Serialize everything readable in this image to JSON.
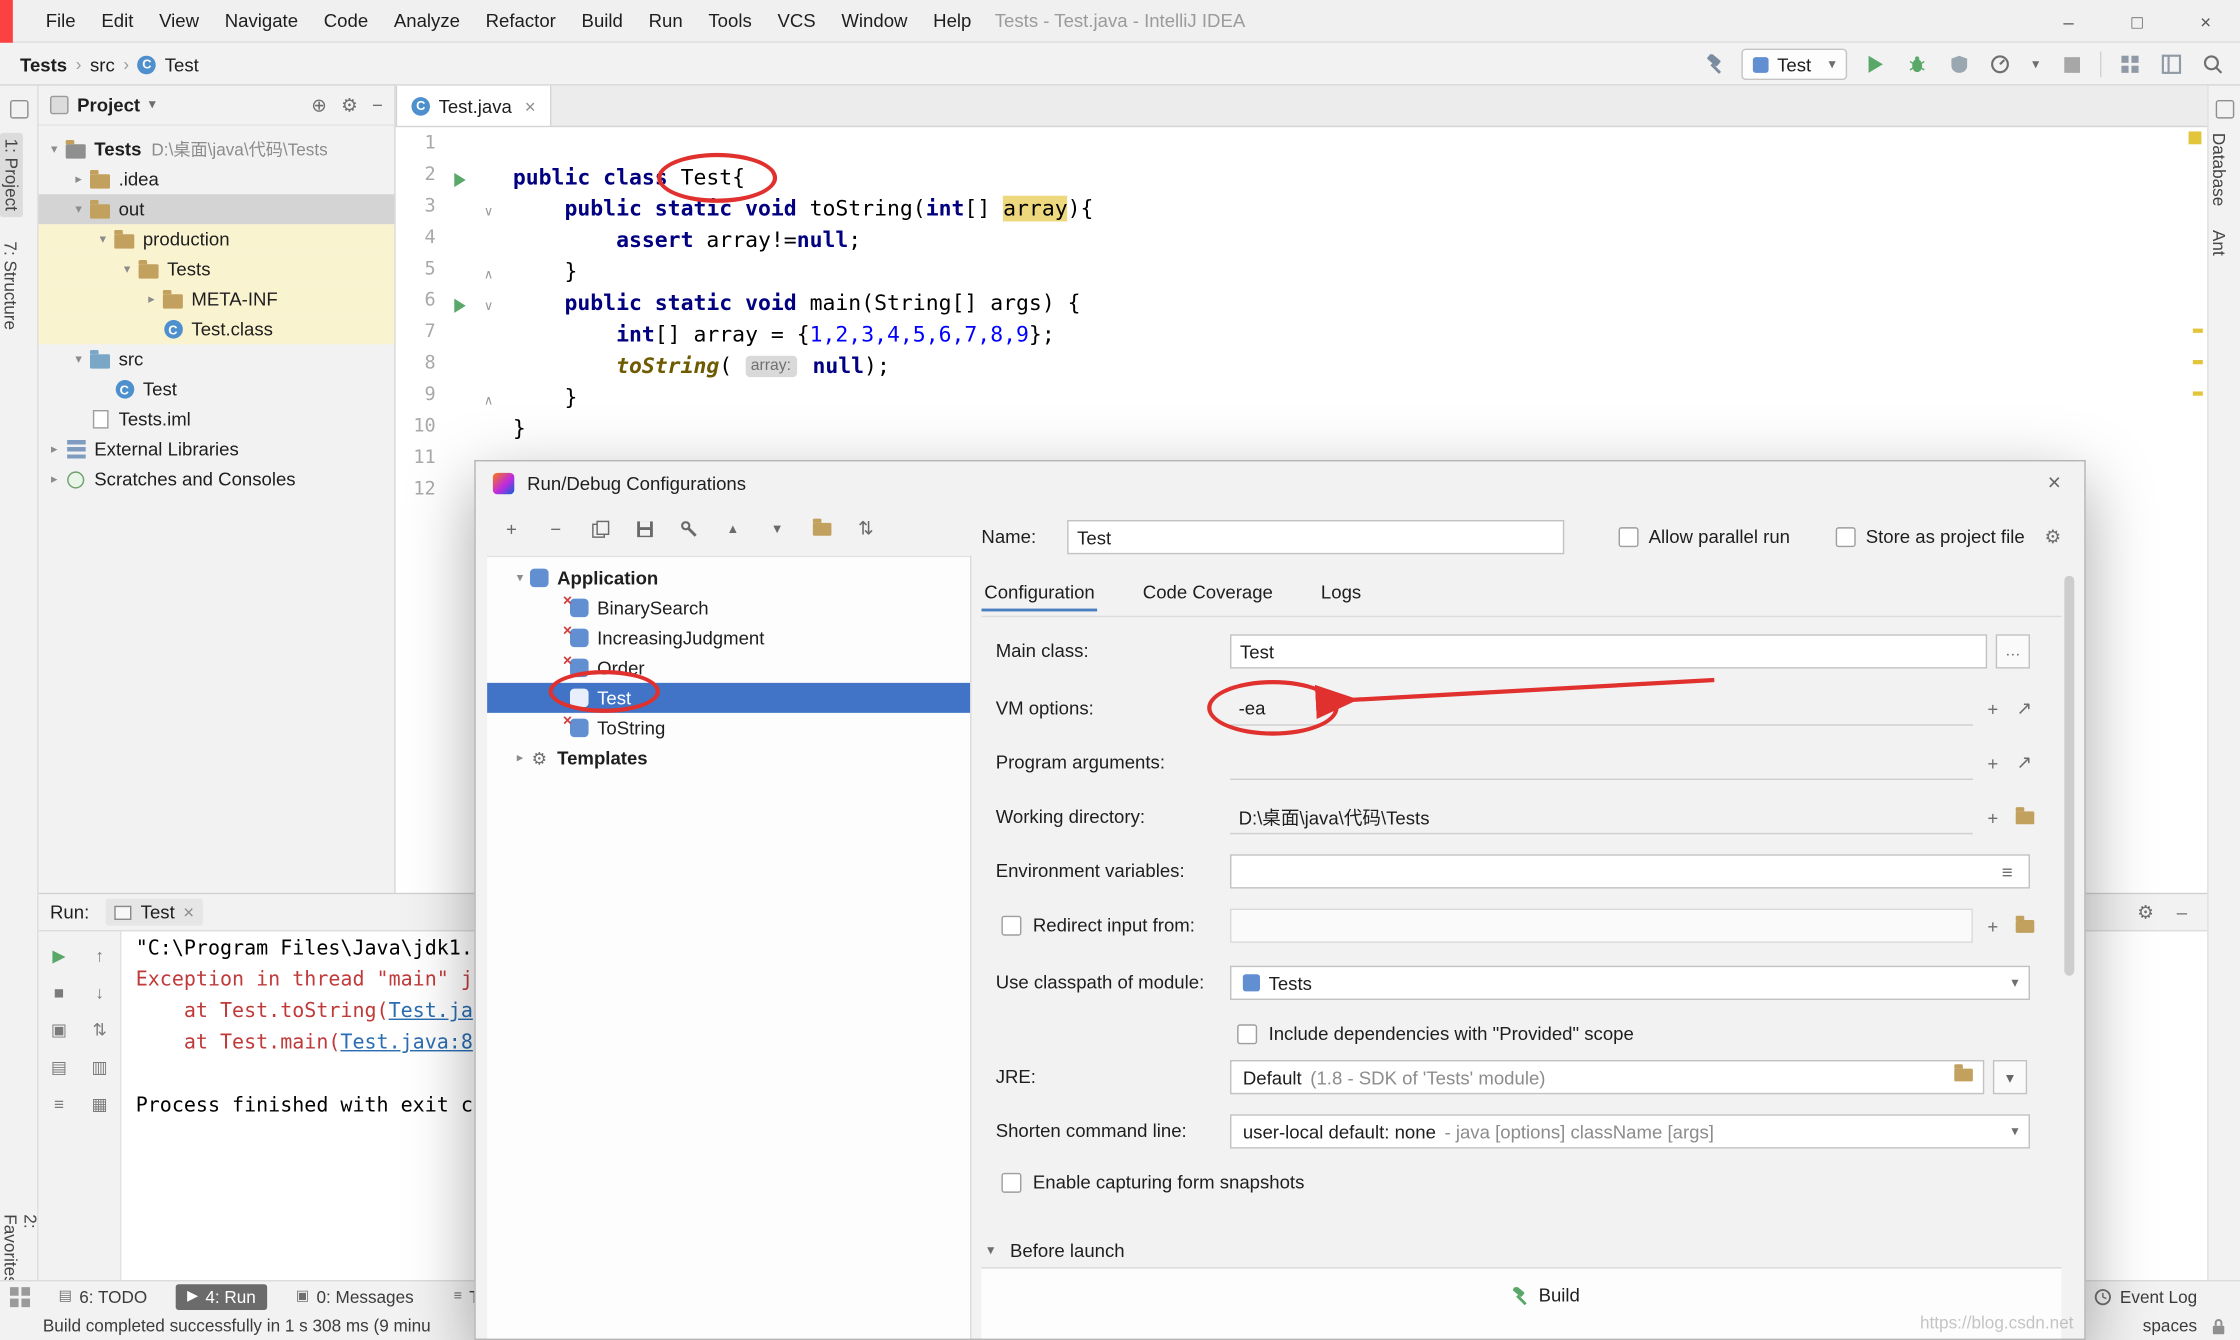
{
  "icons": {
    "crumb": "›",
    "tree_open": "▾",
    "tree_closed": "▸",
    "combo_arrow": "▾",
    "close": "×",
    "minimize": "–",
    "maximize": "□",
    "plus": "+",
    "minus": "−",
    "up": "▲",
    "down": "▼",
    "sort": "⇅",
    "more": "…",
    "gear": "⚙",
    "arrow_up": "↑",
    "arrow_down": "↓",
    "menu": "≡",
    "locate": "⊕",
    "expand": "↗",
    "fold_open": "∨",
    "fold_close": "∧"
  },
  "titlebar": {
    "title": "Tests - Test.java - IntelliJ IDEA",
    "menus": [
      "File",
      "Edit",
      "View",
      "Navigate",
      "Code",
      "Analyze",
      "Refactor",
      "Build",
      "Run",
      "Tools",
      "VCS",
      "Window",
      "Help"
    ]
  },
  "navbar": {
    "breadcrumbs": [
      "Tests",
      "src",
      "Test"
    ],
    "run_config": "Test"
  },
  "stripes": {
    "left_top": [
      "1: Project",
      "7: Structure"
    ],
    "left_bottom": [
      "2: Favorites"
    ],
    "right": [
      "Database",
      "Ant"
    ]
  },
  "project_panel": {
    "title": "Project",
    "tree": [
      {
        "label": "Tests",
        "hint": "D:\\桌面\\java\\代码\\Tests",
        "icon": "project",
        "level": 0,
        "chev": "v",
        "bold": true
      },
      {
        "label": ".idea",
        "icon": "folder",
        "level": 1,
        "chev": ">"
      },
      {
        "label": "out",
        "icon": "folder",
        "level": 1,
        "chev": "v",
        "row": "gray"
      },
      {
        "label": "production",
        "icon": "folder",
        "level": 2,
        "chev": "v",
        "row": "cream"
      },
      {
        "label": "Tests",
        "icon": "folder",
        "level": 3,
        "chev": "v",
        "row": "cream"
      },
      {
        "label": "META-INF",
        "icon": "folder",
        "level": 4,
        "chev": ">",
        "row": "cream"
      },
      {
        "label": "Test.class",
        "icon": "class",
        "level": 4,
        "row": "cream"
      },
      {
        "label": "src",
        "icon": "srcfolder",
        "level": 1,
        "chev": "v"
      },
      {
        "label": "Test",
        "icon": "class",
        "level": 2
      },
      {
        "label": "Tests.iml",
        "icon": "file",
        "level": 1
      },
      {
        "label": "External Libraries",
        "icon": "libs",
        "level": 0,
        "chev": ">"
      },
      {
        "label": "Scratches and Consoles",
        "icon": "scratch",
        "level": 0,
        "chev": ">"
      }
    ]
  },
  "editor": {
    "tab": "Test.java",
    "lines": [
      {
        "n": "1",
        "seg": []
      },
      {
        "n": "2",
        "run": true,
        "seg": [
          {
            "t": "public class ",
            "c": "kw"
          },
          {
            "t": "Test{",
            "c": "p"
          }
        ]
      },
      {
        "n": "3",
        "fold": "v",
        "seg": [
          {
            "t": "    ",
            "c": "p"
          },
          {
            "t": "public static void ",
            "c": "kw"
          },
          {
            "t": "toString(",
            "c": "p"
          },
          {
            "t": "int",
            "c": "kw"
          },
          {
            "t": "[] ",
            "c": "p"
          },
          {
            "t": "array",
            "c": "hl"
          },
          {
            "t": "){",
            "c": "p"
          }
        ]
      },
      {
        "n": "4",
        "seg": [
          {
            "t": "        ",
            "c": "p"
          },
          {
            "t": "assert ",
            "c": "kw"
          },
          {
            "t": "array!=",
            "c": "p"
          },
          {
            "t": "null",
            "c": "kw"
          },
          {
            "t": ";",
            "c": "p"
          }
        ]
      },
      {
        "n": "5",
        "fold": "^",
        "seg": [
          {
            "t": "    }",
            "c": "p"
          }
        ]
      },
      {
        "n": "6",
        "run": true,
        "fold": "v",
        "seg": [
          {
            "t": "    ",
            "c": "p"
          },
          {
            "t": "public static void ",
            "c": "kw"
          },
          {
            "t": "main(String[] args) {",
            "c": "p"
          }
        ]
      },
      {
        "n": "7",
        "seg": [
          {
            "t": "        ",
            "c": "p"
          },
          {
            "t": "int",
            "c": "kw"
          },
          {
            "t": "[] array = {",
            "c": "p"
          },
          {
            "t": "1,2,3,4,5,6,7,8,9",
            "c": "num"
          },
          {
            "t": "};",
            "c": "p"
          }
        ]
      },
      {
        "n": "8",
        "seg": [
          {
            "t": "        ",
            "c": "p"
          },
          {
            "t": "toString",
            "c": "method"
          },
          {
            "t": "( ",
            "c": "p"
          },
          {
            "t": "array:",
            "c": "hint"
          },
          {
            "t": " ",
            "c": "p"
          },
          {
            "t": "null",
            "c": "kw"
          },
          {
            "t": ");",
            "c": "p"
          }
        ]
      },
      {
        "n": "9",
        "fold": "^",
        "seg": [
          {
            "t": "    }",
            "c": "p"
          }
        ]
      },
      {
        "n": "10",
        "seg": [
          {
            "t": "}",
            "c": "p"
          }
        ]
      },
      {
        "n": "11",
        "seg": []
      },
      {
        "n": "12",
        "seg": []
      }
    ]
  },
  "dialog": {
    "title": "Run/Debug Configurations",
    "tree": [
      {
        "label": "Application",
        "icon": "app",
        "level": 0,
        "chev": "v",
        "bold": true
      },
      {
        "label": "BinarySearch",
        "icon": "app-broken",
        "level": 1
      },
      {
        "label": "IncreasingJudgment",
        "icon": "app-broken",
        "level": 1
      },
      {
        "label": "Order",
        "icon": "app-broken",
        "level": 1
      },
      {
        "label": "Test",
        "icon": "app",
        "level": 1,
        "selected": true
      },
      {
        "label": "ToString",
        "icon": "app-broken",
        "level": 1
      },
      {
        "label": "Templates",
        "icon": "wrench",
        "level": 0,
        "chev": ">",
        "bold": true
      }
    ],
    "name_label": "Name:",
    "name_value": "Test",
    "allow_parallel": "Allow parallel run",
    "store_project": "Store as project file",
    "tabs": [
      "Configuration",
      "Code Coverage",
      "Logs"
    ],
    "fields": {
      "main_class": {
        "label": "Main class:",
        "value": "Test"
      },
      "vm_options": {
        "label": "VM options:",
        "value": "-ea"
      },
      "program_args": {
        "label": "Program arguments:",
        "value": ""
      },
      "working_dir": {
        "label": "Working directory:",
        "value": "D:\\桌面\\java\\代码\\Tests"
      },
      "env_vars": {
        "label": "Environment variables:",
        "value": ""
      },
      "redirect": {
        "label": "Redirect input from:",
        "value": ""
      },
      "classpath": {
        "label": "Use classpath of module:",
        "value": "Tests"
      },
      "provided": {
        "label": "Include dependencies with \"Provided\" scope"
      },
      "jre": {
        "label": "JRE:",
        "value": "Default",
        "hint": "(1.8 - SDK of 'Tests' module)"
      },
      "shorten": {
        "label": "Shorten command line:",
        "value": "user-local default: none",
        "hint": "- java [options] className [args]"
      },
      "snapshots": {
        "label": "Enable capturing form snapshots"
      }
    },
    "before_launch": {
      "title": "Before launch",
      "item": "Build"
    }
  },
  "run_panel": {
    "label": "Run:",
    "tab": "Test",
    "toolbar_col1": [
      {
        "name": "rerun-button",
        "glyph": "▶",
        "green": true
      },
      {
        "name": "stop-button",
        "glyph": "■"
      },
      {
        "name": "thread-dump-button",
        "glyph": "▣"
      },
      {
        "name": "restore-layout-button",
        "glyph": "▤"
      },
      {
        "name": "console-settings-button",
        "glyph": "≡"
      }
    ],
    "toolbar_col2": [
      {
        "name": "up-stack-button",
        "glyph": "↑"
      },
      {
        "name": "down-stack-button",
        "glyph": "↓"
      },
      {
        "name": "soft-wrap-button",
        "glyph": "⇅"
      },
      {
        "name": "scroll-end-button",
        "glyph": "▥"
      },
      {
        "name": "print-button",
        "glyph": "▦"
      }
    ],
    "console": [
      [
        {
          "t": "\"C:\\Program Files\\Java\\jdk1.",
          "c": "black"
        }
      ],
      [
        {
          "t": "Exception in thread \"main\" j",
          "c": "red"
        }
      ],
      [
        {
          "t": "    at Test.toString(",
          "c": "red"
        },
        {
          "t": "Test.ja",
          "c": "link"
        }
      ],
      [
        {
          "t": "    at Test.main(",
          "c": "red"
        },
        {
          "t": "Test.java:8",
          "c": "link"
        }
      ],
      [],
      [
        {
          "t": "Process finished with exit c",
          "c": "black"
        }
      ]
    ]
  },
  "bottom": {
    "tabs": [
      {
        "name": "tab-todo",
        "glyph": "▤",
        "label": "6: TODO"
      },
      {
        "name": "tab-run",
        "glyph": "▶",
        "label": "4: Run",
        "selected": true
      },
      {
        "name": "tab-messages",
        "glyph": "▣",
        "label": "0: Messages"
      },
      {
        "name": "tab-terminal",
        "glyph": "≡",
        "label": "Ter"
      }
    ],
    "event_log": "Event Log",
    "status": "Build completed successfully in 1 s 308 ms (9 minu",
    "spaces": "spaces",
    "watermark": "https://blog.csdn.net"
  }
}
